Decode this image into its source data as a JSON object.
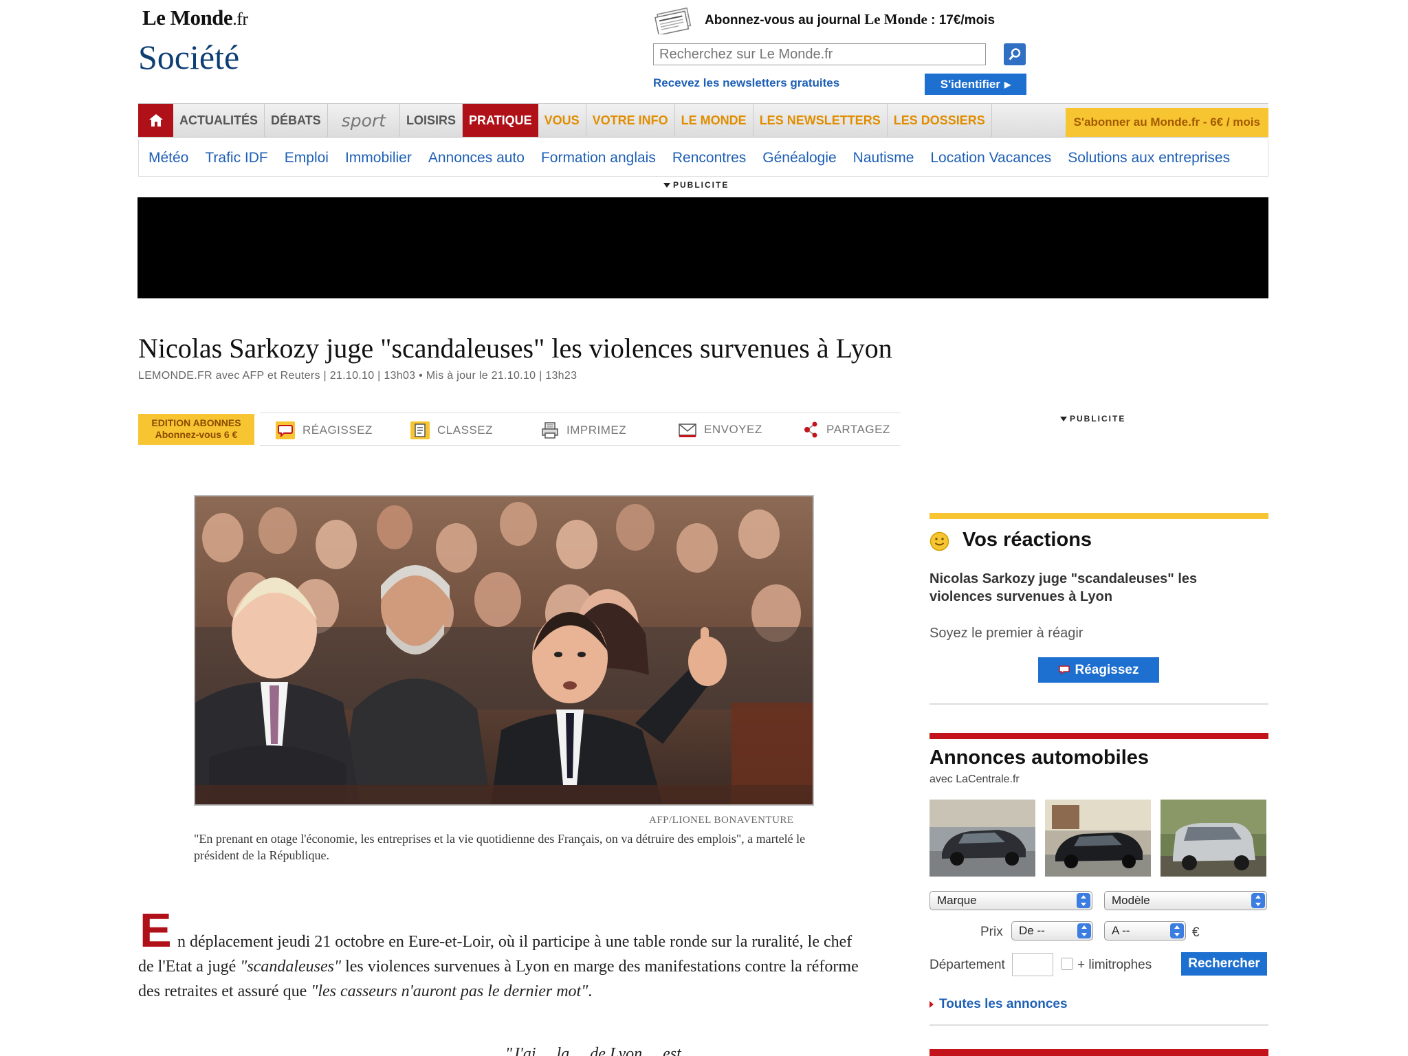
{
  "header": {
    "logo_text": "Le Monde",
    "logo_suffix": ".fr",
    "section_title": "Société",
    "subscribe_prefix": "Abonnez-vous au journal",
    "subscribe_brand": "Le Monde",
    "subscribe_price": ": 17€/mois",
    "search_placeholder": "Recherchez sur Le Monde.fr",
    "newsletters_link": "Recevez les newsletters gratuites",
    "login_button": "S'identifier"
  },
  "main_nav": [
    {
      "label": "ACTUALITÉS",
      "style": "normal"
    },
    {
      "label": "DÉBATS",
      "style": "normal"
    },
    {
      "label": "sport",
      "style": "sport"
    },
    {
      "label": "LOISIRS",
      "style": "normal"
    },
    {
      "label": "PRATIQUE",
      "style": "active"
    },
    {
      "label": "VOUS",
      "style": "orange"
    },
    {
      "label": "VOTRE INFO",
      "style": "orange"
    },
    {
      "label": "LE MONDE",
      "style": "orange"
    },
    {
      "label": "LES NEWSLETTERS",
      "style": "orange"
    },
    {
      "label": "LES DOSSIERS",
      "style": "orange"
    }
  ],
  "promo_nav": "S'abonner au Monde.fr - 6€ / mois",
  "sub_nav": [
    "Météo",
    "Trafic IDF",
    "Emploi",
    "Immobilier",
    "Annonces auto",
    "Formation anglais",
    "Rencontres",
    "Généalogie",
    "Nautisme",
    "Location Vacances",
    "Solutions aux entreprises"
  ],
  "ad_label": "PUBLICITE",
  "article": {
    "title": "Nicolas Sarkozy juge \"scandaleuses\" les violences survenues à Lyon",
    "byline": "LEMONDE.FR avec AFP et Reuters | 21.10.10 | 13h03  •  Mis à jour le 21.10.10 | 13h23",
    "photo_credit": "AFP/LIONEL BONAVENTURE",
    "caption": "\"En prenant en otage l'économie, les entreprises et la vie quotidienne des Français, on va détruire des emplois\", a martelé le président de la République.",
    "dropcap": "E",
    "body_1": "n déplacement jeudi 21 octobre en Eure-et-Loir, où il participe à une table ronde sur la ruralité, le chef de l'Etat a jugé ",
    "body_quote_1": "\"scandaleuses\"",
    "body_2": " les violences survenues à Lyon en marge des manifestations contre la réforme des retraites et assuré que ",
    "body_quote_2": "\"les casseurs n'auront pas le dernier mot\"",
    "body_3": ".",
    "body_cut": "\"J'ai ... la ... de Lyon ... est ..."
  },
  "toolbar": {
    "edition_line1": "EDITION ABONNES",
    "edition_line2": "Abonnez-vous 6 €",
    "react": "RÉAGISSEZ",
    "classify": "CLASSEZ",
    "print": "IMPRIMEZ",
    "send": "ENVOYEZ",
    "share": "PARTAGEZ"
  },
  "reactions": {
    "title": "Vos réactions",
    "article_title": "Nicolas Sarkozy juge \"scandaleuses\" les violences survenues à Lyon",
    "first_prompt": "Soyez le premier à réagir",
    "button": "Réagissez"
  },
  "car_ads": {
    "title": "Annonces automobiles",
    "subtitle": "avec LaCentrale.fr",
    "brand_select": "Marque",
    "model_select": "Modèle",
    "price_label": "Prix",
    "price_from": "De --",
    "price_to": "A --",
    "currency": "€",
    "department_label": "Département",
    "neighbors_label": "+ limitrophes",
    "search_button": "Rechercher",
    "all_ads_link": "Toutes les annonces"
  },
  "colors": {
    "brand_red": "#b01017",
    "link_blue": "#1d5fb5",
    "accent_yellow": "#f7c531"
  }
}
